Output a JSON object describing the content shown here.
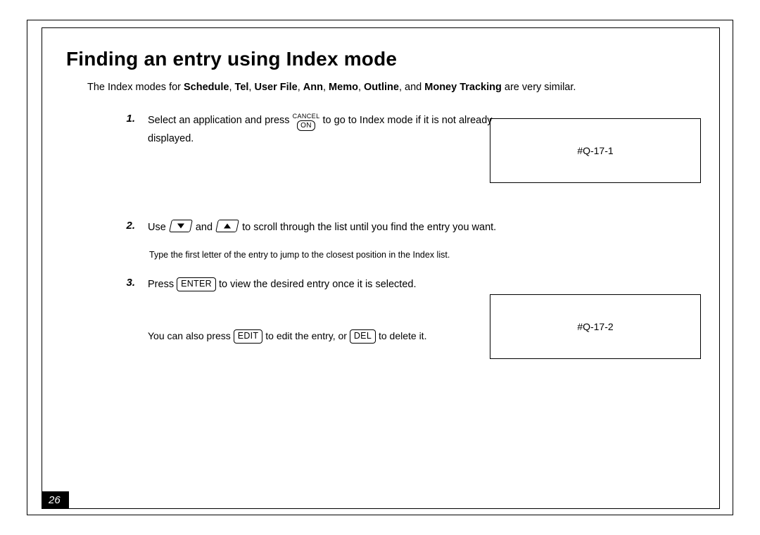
{
  "title": "Finding an entry using Index mode",
  "intro": {
    "prefix": "The Index modes for ",
    "apps": [
      "Schedule",
      "Tel",
      "User File",
      "Ann",
      "Memo",
      "Outline",
      "Money Tracking"
    ],
    "sep": ", ",
    "and": "and ",
    "suffix": " are very similar."
  },
  "steps": {
    "s1": {
      "num": "1.",
      "text_a": "Select an application and press ",
      "cancel_top": "CANCEL",
      "cancel_on": "ON",
      "text_b": " to go to Index mode if it is not already displayed."
    },
    "s2": {
      "num": "2.",
      "text_a": "Use ",
      "text_mid": " and ",
      "text_b": " to scroll through the list until you find the entry you want."
    },
    "subnote": "Type the first letter of the entry to jump to the closest position in the Index list.",
    "s3": {
      "num": "3.",
      "text_a": "Press ",
      "enter": "ENTER",
      "text_b": " to view the desired entry once it is selected."
    }
  },
  "footnote": {
    "a": "You can also press ",
    "edit": "EDIT",
    "b": " to edit the entry, or ",
    "del": "DEL",
    "c": " to delete it."
  },
  "refs": {
    "r1": "#Q-17-1",
    "r2": "#Q-17-2"
  },
  "page_number": "26"
}
